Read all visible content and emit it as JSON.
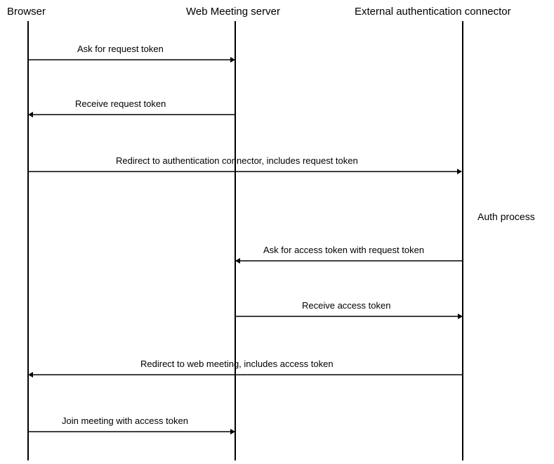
{
  "participants": {
    "browser": "Browser",
    "server": "Web Meeting server",
    "connector": "External authentication connector"
  },
  "messages": {
    "m1": "Ask for request token",
    "m2": "Receive request token",
    "m3": "Redirect to authentication connector, includes request token",
    "m4": "Ask for access token with request token",
    "m5": "Receive access token",
    "m6": "Redirect to web meeting, includes access token",
    "m7": "Join meeting with access token"
  },
  "annotations": {
    "auth_process": "Auth process"
  }
}
